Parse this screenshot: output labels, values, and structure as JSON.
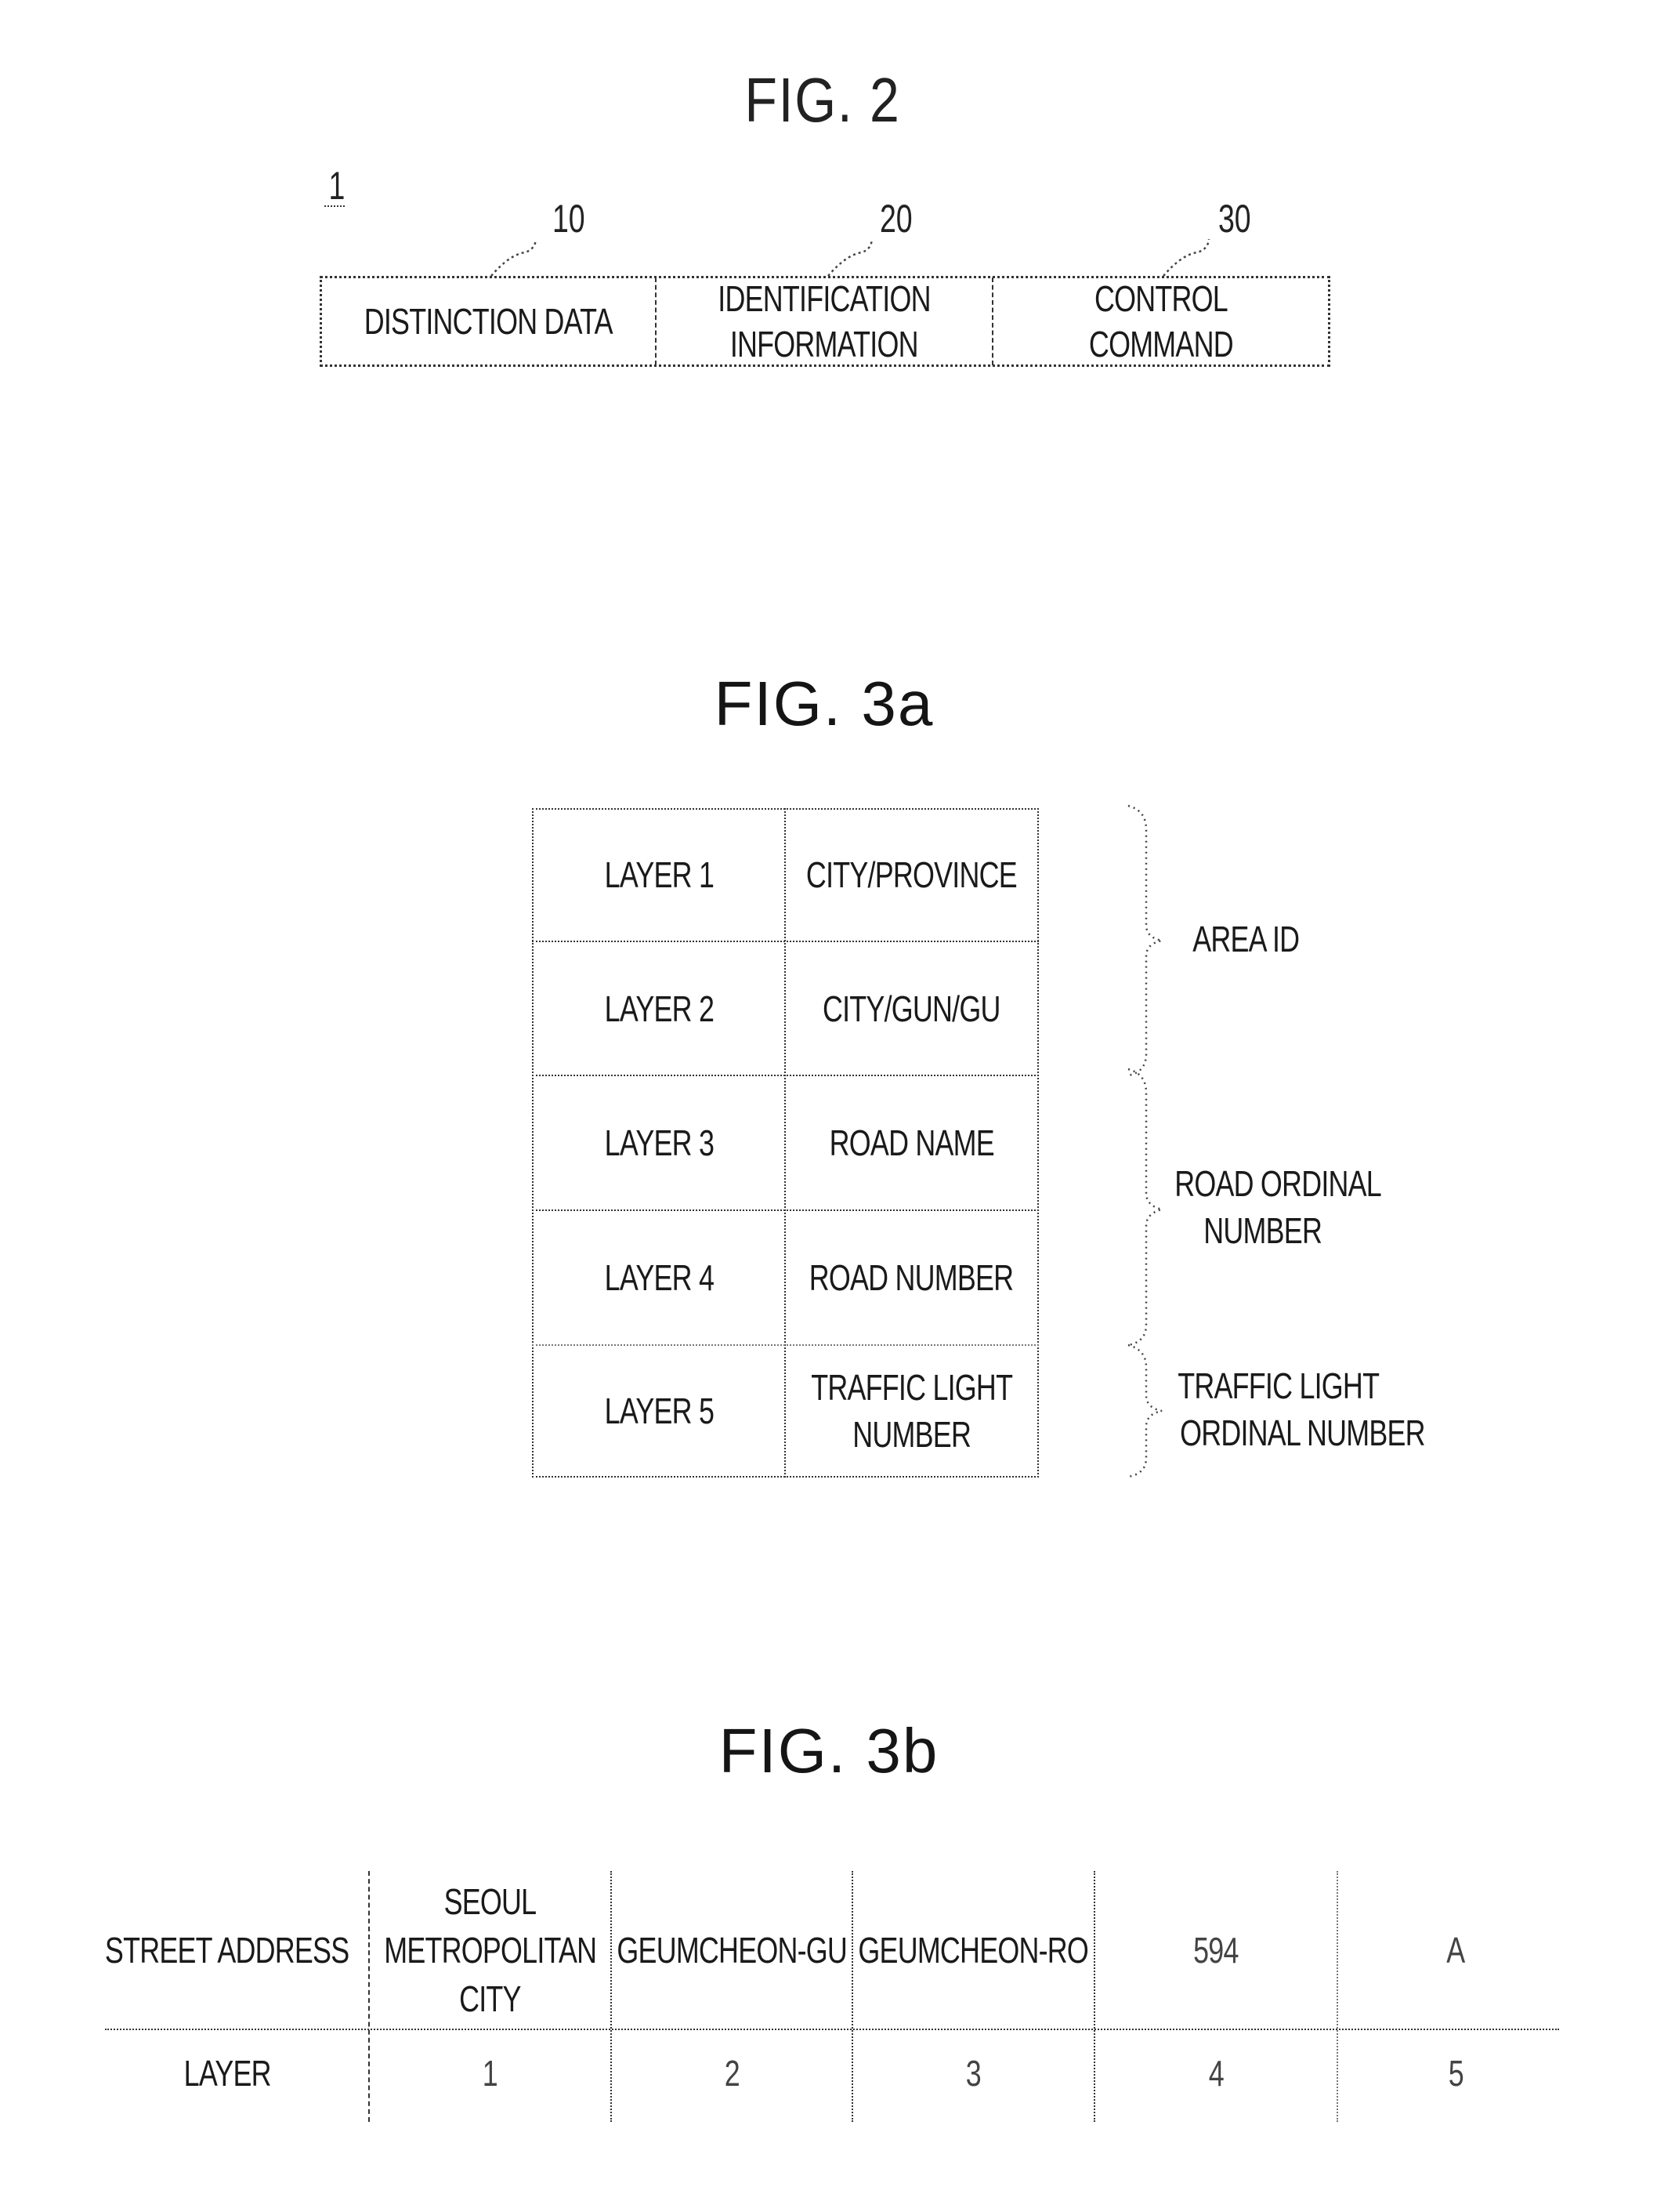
{
  "fig2": {
    "title": "FIG. 2",
    "ref_main": "1",
    "fields": [
      {
        "ref": "10",
        "lines": [
          "DISTINCTION DATA"
        ]
      },
      {
        "ref": "20",
        "lines": [
          "IDENTIFICATION",
          "INFORMATION"
        ]
      },
      {
        "ref": "30",
        "lines": [
          "CONTROL",
          "COMMAND"
        ]
      }
    ]
  },
  "fig3a": {
    "title": "FIG. 3a",
    "rows": [
      {
        "layer": "LAYER 1",
        "content": [
          "CITY/PROVINCE"
        ]
      },
      {
        "layer": "LAYER 2",
        "content": [
          "CITY/GUN/GU"
        ]
      },
      {
        "layer": "LAYER 3",
        "content": [
          "ROAD NAME"
        ]
      },
      {
        "layer": "LAYER 4",
        "content": [
          "ROAD NUMBER"
        ]
      },
      {
        "layer": "LAYER 5",
        "content": [
          "TRAFFIC LIGHT",
          "NUMBER"
        ]
      }
    ],
    "groups": [
      {
        "label": [
          "AREA ID"
        ],
        "spans_layers": [
          1,
          2
        ]
      },
      {
        "label": [
          "ROAD ORDINAL",
          "NUMBER"
        ],
        "spans_layers": [
          3,
          4
        ]
      },
      {
        "label": [
          "TRAFFIC LIGHT",
          "ORDINAL NUMBER"
        ],
        "spans_layers": [
          5
        ]
      }
    ]
  },
  "fig3b": {
    "title": "FIG. 3b",
    "header_row_label": "STREET ADDRESS",
    "layer_row_label": "LAYER",
    "columns": [
      {
        "address": [
          "SEOUL",
          "METROPOLITAN",
          "CITY"
        ],
        "layer": "1"
      },
      {
        "address": [
          "GEUMCHEON-GU"
        ],
        "layer": "2"
      },
      {
        "address": [
          "GEUMCHEON-RO"
        ],
        "layer": "3"
      },
      {
        "address": [
          "594"
        ],
        "layer": "4"
      },
      {
        "address": [
          "A"
        ],
        "layer": "5"
      }
    ]
  }
}
